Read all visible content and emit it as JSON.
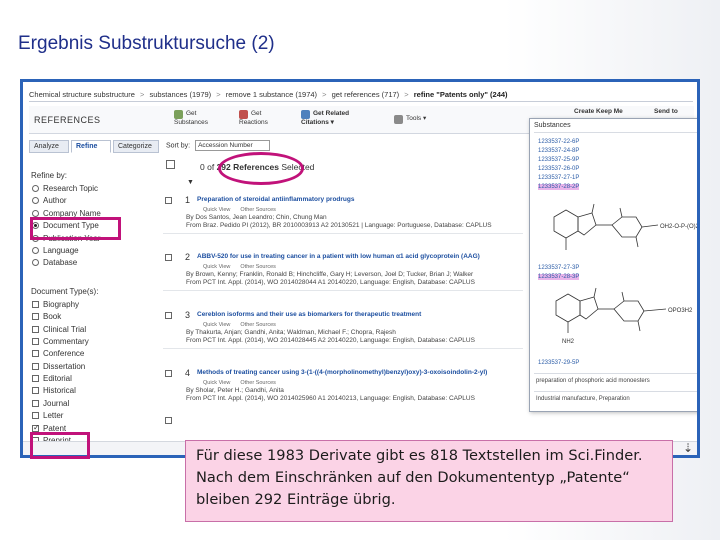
{
  "slide_title": "Ergebnis Substruktursuche (2)",
  "breadcrumb": {
    "items": [
      "Chemical structure substructure",
      "substances (1979)",
      "remove 1 substance (1974)",
      "get references (717)"
    ],
    "current": "refine \"Patents only\" (244)",
    "separator": ">"
  },
  "toolbar": {
    "title": "REFERENCES",
    "get_substances": "Get Substances",
    "get_reactions": "Get Reactions",
    "get_related_citations": "Get Related Citations",
    "tools": "Tools",
    "create_keep_me": "Create Keep Me",
    "send_to": "Send to"
  },
  "tabs": {
    "analyze": "Analyze",
    "refine": "Refine",
    "categorize": "Categorize"
  },
  "sort": {
    "label": "Sort by:",
    "value": "Accession Number"
  },
  "count_line": {
    "prefix": "0 of",
    "count": "292 References",
    "suffix": "Selected"
  },
  "refine": {
    "heading": "Refine by:",
    "options": [
      "Research Topic",
      "Author",
      "Company Name",
      "Document Type",
      "Publication Year",
      "Language",
      "Database"
    ],
    "selected_option": "Document Type",
    "doc_heading": "Document Type(s):",
    "doc_types": [
      "Biography",
      "Book",
      "Clinical Trial",
      "Commentary",
      "Conference",
      "Dissertation",
      "Editorial",
      "Historical",
      "Journal",
      "Letter",
      "Patent",
      "Preprint"
    ],
    "checked_doc_type": "Patent"
  },
  "results": [
    {
      "index": "1",
      "title": "Preparation of steroidal antiinflammatory prodrugs",
      "links": [
        "Quick View",
        "Other Sources"
      ],
      "by": "By Dos Santos, Jean Leandro; Chin, Chung Man",
      "source": "From Braz. Pedido PI (2012), BR 2010003913 A2 20130521 | Language: Portuguese, Database: CAPLUS"
    },
    {
      "index": "2",
      "title": "ABBV-520 for use in treating cancer in a patient with low human α1 acid glycoprotein (AAG)",
      "links": [
        "Quick View",
        "Other Sources"
      ],
      "by": "By Brown, Kenny; Franklin, Ronald B; Hinchcliffe, Gary H; Leverson, Joel D; Tucker, Brian J; Walker",
      "source": "From PCT Int. Appl. (2014), WO 2014028044 A1 20140220, Language: English, Database: CAPLUS"
    },
    {
      "index": "3",
      "title": "Cereblon isoforms and their use as biomarkers for therapeutic treatment",
      "links": [
        "Quick View",
        "Other Sources"
      ],
      "by": "By Thakurta, Anjan; Gandhi, Anita; Waldman, Michael F.; Chopra, Rajesh",
      "source": "From PCT Int. Appl. (2014), WO 2014028445 A2 20140220, Language: English, Database: CAPLUS"
    },
    {
      "index": "4",
      "title": "Methods of treating cancer using 3-(1-((4-(morpholinomethyl)benzyl)oxy)-3-oxoisoindolin-2-yl)",
      "links": [
        "Quick View",
        "Other Sources"
      ],
      "by": "By Sholar, Peter H.; Gandhi, Anita",
      "source": "From PCT Int. Appl. (2014), WO 2014025960 A1 20140213, Language: English, Database: CAPLUS"
    }
  ],
  "popup": {
    "heading": "Substances",
    "rns_top": [
      "1233537-22-6P",
      "1233537-24-8P",
      "1233537-25-9P",
      "1233537-26-0P",
      "1233537-27-1P",
      "1233537-28-2P"
    ],
    "rn_mid": "1233537-27-3P",
    "rn_mid2": "1233537-28-3P",
    "rn_bottom": "1233537-29-5P",
    "foot_1": "preparation of phosphoric acid monoesters",
    "foot_2": "Industrial manufacture, Preparation",
    "substituent_1": "OH2-O-P-(O)2",
    "substituent_2": "OPO3H2",
    "nh2_label": "NH2"
  },
  "caption": "Für diese 1983 Derivate gibt es 818 Textstellen  im Sci.Finder. Nach dem Einschränken auf den Dokumententyp „Patente“ bleiben 292 Einträge übrig.",
  "colors": {
    "title": "#1f2f8a",
    "frame": "#2b63b8",
    "highlight": "#c1127a",
    "caption_bg": "#fbd3e6",
    "link": "#1d4fa0"
  }
}
